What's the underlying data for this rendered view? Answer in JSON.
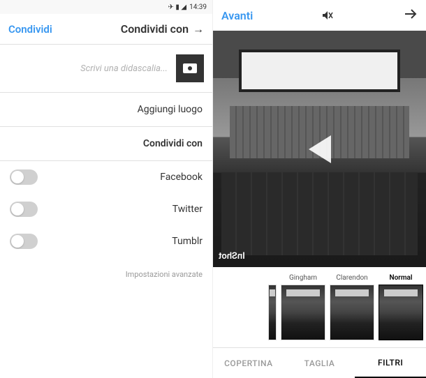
{
  "status": {
    "time": "14:39",
    "icons": [
      "airplane",
      "battery",
      "signal"
    ]
  },
  "left": {
    "header": {
      "back_icon": "←",
      "title": "Condividi con",
      "action": "Condividi"
    },
    "caption": {
      "placeholder": "Scrivi una didascalia..."
    },
    "add_location": "Aggiungi luogo",
    "share_with_header": "Condividi con",
    "networks": [
      {
        "label": "Facebook",
        "enabled": false
      },
      {
        "label": "Twitter",
        "enabled": false
      },
      {
        "label": "Tumblr",
        "enabled": false
      }
    ],
    "advanced": "Impostazioni avanzate"
  },
  "right": {
    "header": {
      "next": "Avanti",
      "sound_muted": true
    },
    "video": {
      "watermark": "InShot"
    },
    "filters": [
      {
        "name": "Gingham",
        "active": false
      },
      {
        "name": "Clarendon",
        "active": false
      },
      {
        "name": "Normal",
        "active": true
      }
    ],
    "tabs": [
      {
        "label": "COPERTINA",
        "active": false
      },
      {
        "label": "TAGLIA",
        "active": false
      },
      {
        "label": "FILTRI",
        "active": true
      }
    ]
  }
}
